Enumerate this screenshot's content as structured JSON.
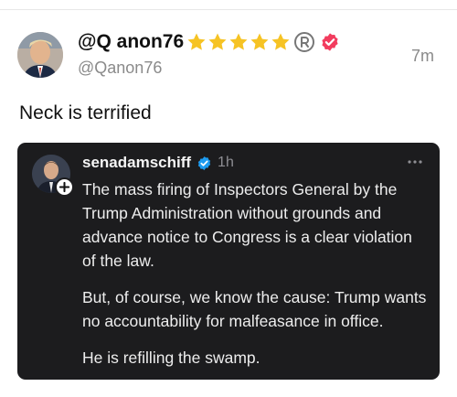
{
  "post": {
    "author_name": "@Q anon76",
    "handle": "@Qanon76",
    "time": "7m",
    "text": "Neck is terrified",
    "icons": {
      "avatar": "avatar",
      "stars": "star-icon",
      "registered": "registered-icon",
      "verified": "verified-badge-icon"
    },
    "colors": {
      "star": "#f6c324",
      "verified_badge": "#f23c5e"
    }
  },
  "quote": {
    "author": "senadamschiff",
    "time": "1h",
    "paragraphs": [
      "The mass firing of Inspectors General by the Trump Administration without grounds and advance notice to Congress is a clear violation of the law.",
      "But, of course, we know the cause: Trump wants no accountability for malfeasance in office.",
      "He is refilling the swamp."
    ],
    "icons": {
      "verified": "verified-badge-icon",
      "more": "more-options-icon",
      "follow": "follow-plus-icon"
    },
    "colors": {
      "background": "#1c1c1e",
      "verified_badge": "#1d9bf0"
    }
  }
}
